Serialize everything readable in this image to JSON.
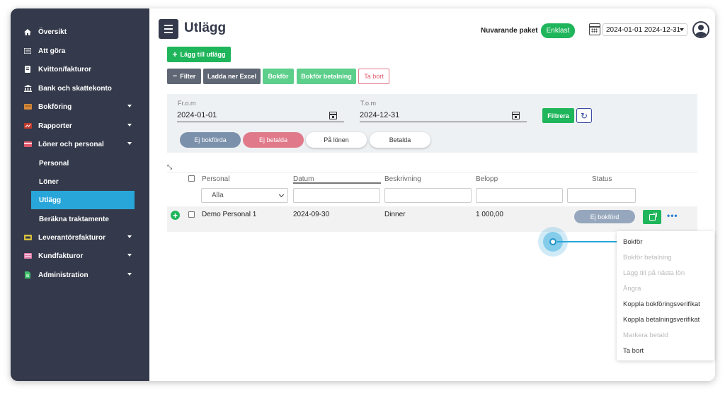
{
  "sidebar": {
    "items": [
      {
        "label": "Översikt",
        "icon": "home-icon"
      },
      {
        "label": "Att göra",
        "icon": "list-icon"
      },
      {
        "label": "Kvitton/fakturor",
        "icon": "receipt-icon"
      },
      {
        "label": "Bank och skattekonto",
        "icon": "bank-icon"
      },
      {
        "label": "Bokföring",
        "icon": "ledger-icon",
        "expandable": true
      },
      {
        "label": "Rapporter",
        "icon": "report-icon",
        "expandable": true
      },
      {
        "label": "Löner och personal",
        "icon": "card-icon",
        "expandable": true
      },
      {
        "label": "Leverantörsfakturor",
        "icon": "supplier-invoice-icon",
        "expandable": true
      },
      {
        "label": "Kundfakturor",
        "icon": "customer-invoice-icon",
        "expandable": true
      },
      {
        "label": "Administration",
        "icon": "document-icon",
        "expandable": true
      }
    ],
    "subitems": [
      {
        "label": "Personal"
      },
      {
        "label": "Löner"
      },
      {
        "label": "Utlägg",
        "active": true
      },
      {
        "label": "Beräkna traktamente"
      }
    ]
  },
  "header": {
    "title": "Utlägg",
    "package_label": "Nuvarande paket",
    "package_value": "Enklast",
    "date_range": "2024-01-01 2024-12-31"
  },
  "toolbar": {
    "add_label": "Lägg till utlägg",
    "filter_label": "Filter",
    "download_label": "Ladda ner Excel",
    "bokfor_label": "Bokför",
    "bokfor_betalning_label": "Bokför betalning",
    "delete_label": "Ta bort"
  },
  "filters": {
    "from_label": "Fr.o.m",
    "from_value": "2024-01-01",
    "to_label": "T.o.m",
    "to_value": "2024-12-31",
    "apply_label": "Filtrera",
    "pills": [
      "Ej bokförda",
      "Ej betalda",
      "På lönen",
      "Betalda"
    ]
  },
  "table": {
    "columns": [
      "Personal",
      "Datum",
      "Beskrivning",
      "Belopp",
      "Status"
    ],
    "personal_filter": "Alla",
    "rows": [
      {
        "personal": "Demo Personal 1",
        "datum": "2024-09-30",
        "beskrivning": "Dinner",
        "belopp": "1 000,00",
        "status": "Ej bokförd"
      }
    ]
  },
  "menu": {
    "items": [
      {
        "label": "Bokför",
        "enabled": true
      },
      {
        "label": "Bokför betalning",
        "enabled": false
      },
      {
        "label": "Lägg till på nästa lön",
        "enabled": false
      },
      {
        "label": "Ångra",
        "enabled": false
      },
      {
        "label": "Koppla bokföringsverifikat",
        "enabled": true
      },
      {
        "label": "Koppla betalningsverifikat",
        "enabled": true
      },
      {
        "label": "Markera betald",
        "enabled": false
      },
      {
        "label": "Ta bort",
        "enabled": true
      }
    ]
  },
  "colors": {
    "sidebar_bg": "#343a4b",
    "active_item": "#29a6d9",
    "green": "#1fb55b",
    "status_badge": "#96a7bd"
  }
}
